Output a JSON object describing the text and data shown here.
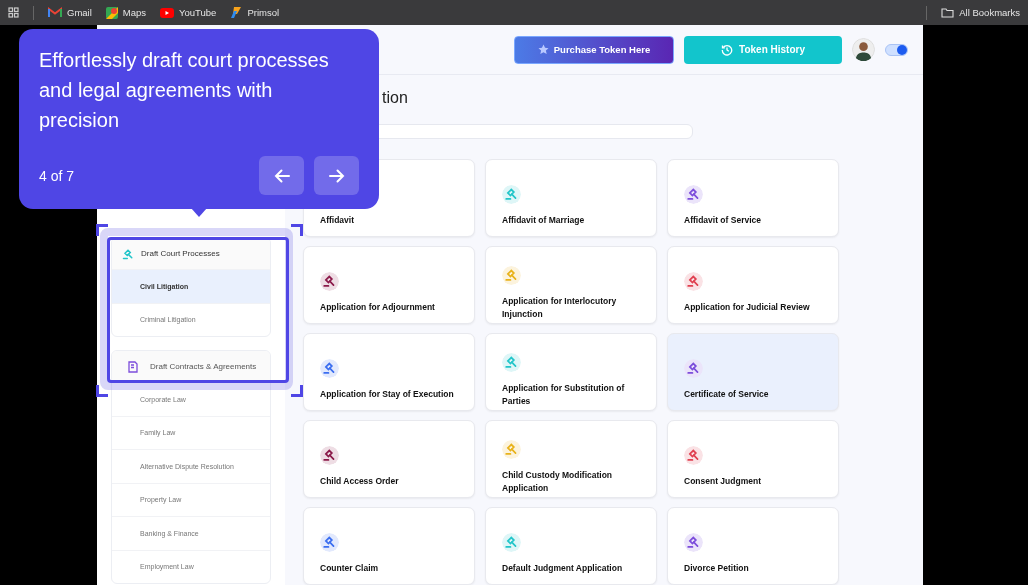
{
  "bookmarks_bar": {
    "bookmarks": [
      {
        "label": "Gmail",
        "kind": "mail"
      },
      {
        "label": "Maps",
        "kind": "map"
      },
      {
        "label": "YouTube",
        "kind": "video"
      },
      {
        "label": "Primsol",
        "kind": "brand"
      }
    ],
    "all_bookmarks": "All Bookmarks"
  },
  "header": {
    "purchase_button": "Purchase Token Here",
    "history_button": "Token History",
    "theme_toggle": {
      "on": true
    }
  },
  "page_title": "tion",
  "sidebar": {
    "groups": [
      {
        "label": "Draft Court Processes",
        "kind": "court",
        "items": [
          {
            "label": "Civil Litigation",
            "selected": true
          },
          {
            "label": "Criminal Litigation",
            "selected": false
          }
        ]
      },
      {
        "label": "Draft Contracts & Agreements",
        "kind": "contract",
        "items": [
          {
            "label": "Corporate Law",
            "selected": false
          },
          {
            "label": "Family Law",
            "selected": false
          },
          {
            "label": "Alternative Dispute Resolution",
            "selected": false
          },
          {
            "label": "Property Law",
            "selected": false
          },
          {
            "label": "Banking & Finance",
            "selected": false
          },
          {
            "label": "Employment Law",
            "selected": false
          }
        ]
      }
    ]
  },
  "documents": [
    {
      "title": "Affidavit",
      "selected": false
    },
    {
      "title": "Affidavit of Marriage",
      "color": "#22c5c9",
      "selected": false
    },
    {
      "title": "Affidavit of Service",
      "color": "#7c4ddb",
      "selected": false
    },
    {
      "title": "Application for Adjournment",
      "color": "#8b1a4a",
      "selected": false
    },
    {
      "title": "Application for Interlocutory Injunction",
      "color": "#e8b21a",
      "selected": false
    },
    {
      "title": "Application for Judicial Review",
      "color": "#e04050",
      "selected": false
    },
    {
      "title": "Application for Stay of Execution",
      "color": "#3b6ef0",
      "selected": false
    },
    {
      "title": "Application for Substitution of Parties",
      "color": "#22c5c9",
      "selected": false
    },
    {
      "title": "Certificate of Service",
      "color": "#7c4ddb",
      "selected": true
    },
    {
      "title": "Child Access Order",
      "color": "#8b1a4a",
      "selected": false
    },
    {
      "title": "Child Custody Modification Application",
      "color": "#e8b21a",
      "selected": false
    },
    {
      "title": "Consent Judgment",
      "color": "#e04050",
      "selected": false
    },
    {
      "title": "Counter Claim",
      "color": "#3b6ef0",
      "selected": false
    },
    {
      "title": "Default Judgment Application",
      "color": "#22c5c9",
      "selected": false
    },
    {
      "title": "Divorce Petition",
      "color": "#7c4ddb",
      "selected": false
    }
  ],
  "tour": {
    "text": "Effortlessly draft court processes and legal agreements with precision",
    "step": "4 of 7"
  }
}
